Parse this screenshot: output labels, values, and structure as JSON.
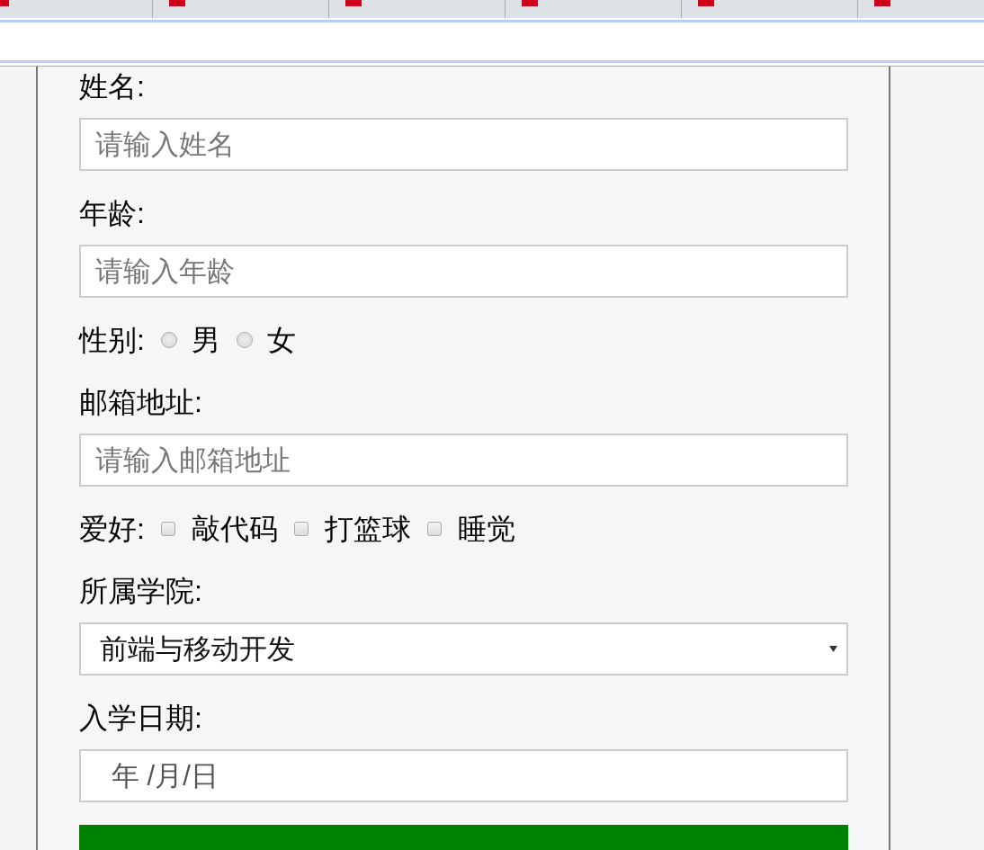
{
  "browser": {
    "tabs": [
      {
        "selected": false
      },
      {
        "selected": false
      },
      {
        "selected": false
      },
      {
        "selected": false
      },
      {
        "selected": false
      },
      {
        "selected": false
      }
    ]
  },
  "form": {
    "fields": [
      {
        "kind": "text",
        "label": "姓名:",
        "placeholder": "请输入姓名"
      },
      {
        "kind": "text",
        "label": "年龄:",
        "placeholder": "请输入年龄"
      },
      {
        "kind": "radio",
        "label": "性别:",
        "options": [
          {
            "label": "男",
            "selected": false
          },
          {
            "label": "女",
            "selected": false
          }
        ]
      },
      {
        "kind": "text",
        "label": "邮箱地址:",
        "placeholder": "请输入邮箱地址"
      },
      {
        "kind": "checkbox",
        "label": "爱好:",
        "options": [
          {
            "label": "敲代码",
            "checked": false
          },
          {
            "label": "打篮球",
            "checked": false
          },
          {
            "label": "睡觉",
            "checked": false
          }
        ]
      },
      {
        "kind": "select",
        "label": "所属学院:",
        "value": "前端与移动开发"
      },
      {
        "kind": "date",
        "label": "入学日期:",
        "placeholder": "年 /月/日"
      }
    ]
  }
}
